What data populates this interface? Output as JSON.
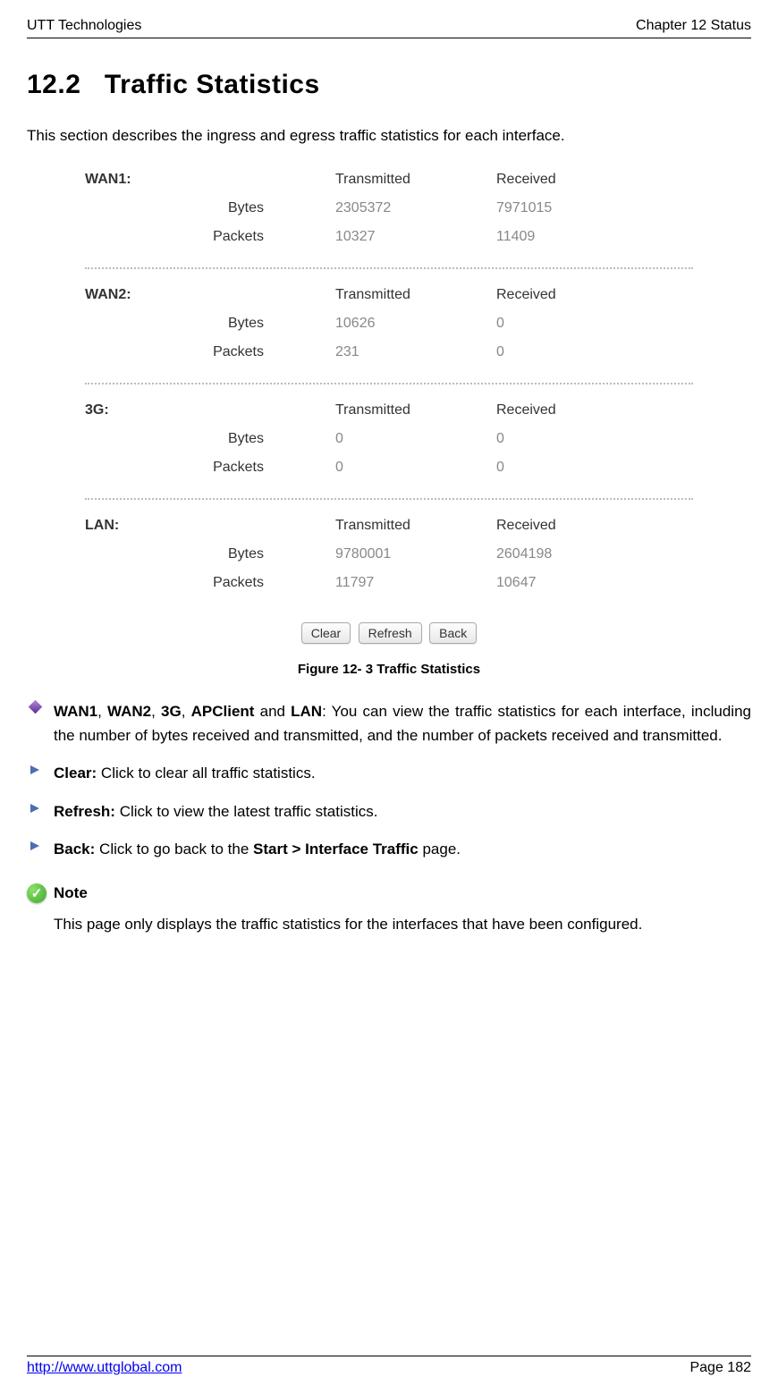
{
  "header": {
    "left": "UTT Technologies",
    "right": "Chapter 12 Status"
  },
  "section": {
    "number": "12.2",
    "title": "Traffic Statistics"
  },
  "intro": "This section describes the ingress and egress traffic statistics for each interface.",
  "columns": {
    "tx": "Transmitted",
    "rx": "Received"
  },
  "row_labels": {
    "bytes": "Bytes",
    "packets": "Packets"
  },
  "interfaces": [
    {
      "name": "WAN1:",
      "bytes_tx": "2305372",
      "bytes_rx": "7971015",
      "packets_tx": "10327",
      "packets_rx": "11409"
    },
    {
      "name": "WAN2:",
      "bytes_tx": "10626",
      "bytes_rx": "0",
      "packets_tx": "231",
      "packets_rx": "0"
    },
    {
      "name": "3G:",
      "bytes_tx": "0",
      "bytes_rx": "0",
      "packets_tx": "0",
      "packets_rx": "0"
    },
    {
      "name": "LAN:",
      "bytes_tx": "9780001",
      "bytes_rx": "2604198",
      "packets_tx": "11797",
      "packets_rx": "10647"
    }
  ],
  "buttons": {
    "clear": "Clear",
    "refresh": "Refresh",
    "back": "Back"
  },
  "figure_caption": "Figure 12- 3 Traffic Statistics",
  "bullets": {
    "desc_prefix_bold_parts": [
      "WAN1",
      "WAN2",
      "3G",
      "APClient",
      "LAN"
    ],
    "desc_text": ": You can view the traffic statistics for each interface, including the number of bytes received and transmitted, and the number of packets received and transmitted.",
    "clear_label": "Clear:",
    "clear_text": " Click to clear all traffic statistics.",
    "refresh_label": "Refresh:",
    "refresh_text": " Click to view the latest traffic statistics.",
    "back_label": "Back:",
    "back_text_1": " Click to go back to the ",
    "back_bold": "Start > Interface Traffic",
    "back_text_2": " page."
  },
  "note": {
    "label": "Note",
    "body": "This page only displays the traffic statistics for the interfaces that have been configured."
  },
  "footer": {
    "url": "http://www.uttglobal.com",
    "page": "Page 182"
  },
  "sep": ", ",
  "and_sep": " and "
}
